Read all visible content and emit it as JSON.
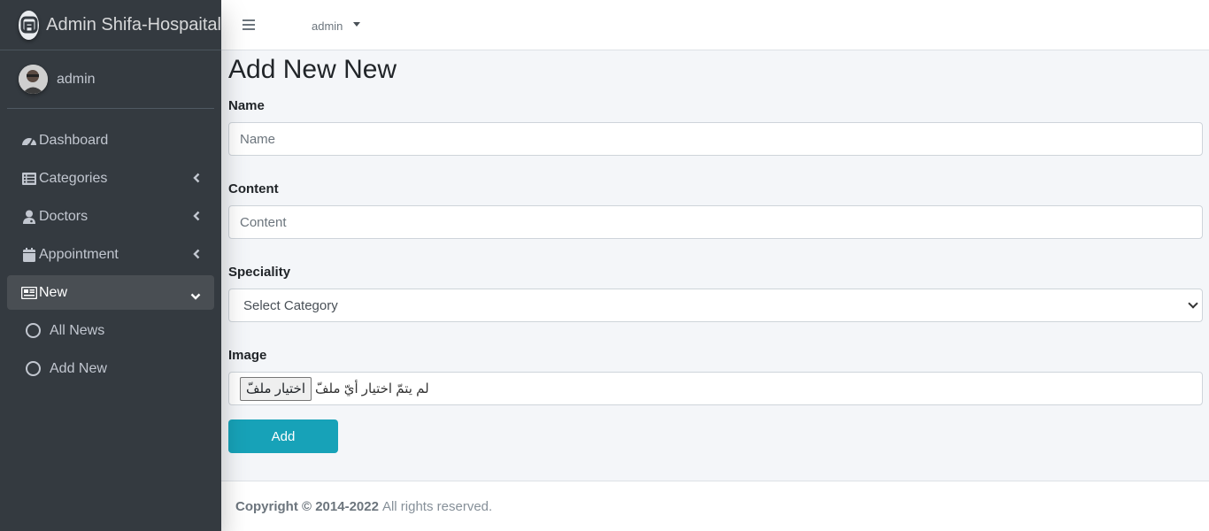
{
  "brand": {
    "title": "Admin Shifa-Hospaital"
  },
  "user": {
    "name": "admin"
  },
  "sidebar": {
    "items": [
      {
        "label": "Dashboard",
        "icon": "tachometer-icon"
      },
      {
        "label": "Categories",
        "icon": "list-icon"
      },
      {
        "label": "Doctors",
        "icon": "user-doctor-icon"
      },
      {
        "label": "Appointment",
        "icon": "calendar-icon"
      },
      {
        "label": "New",
        "icon": "newspaper-icon"
      }
    ],
    "sub_items": [
      {
        "label": "All News"
      },
      {
        "label": "Add New"
      }
    ]
  },
  "header": {
    "user_label": "admin"
  },
  "main": {
    "title": "Add New New",
    "name_label": "Name",
    "name_placeholder": "Name",
    "content_label": "Content",
    "content_placeholder": "Content",
    "speciality_label": "Speciality",
    "speciality_selected": "Select Category",
    "image_label": "Image",
    "file_button": "اختيار ملفّ",
    "file_status": "لم يتمّ اختيار أيّ ملفّ",
    "add_button": "Add"
  },
  "footer": {
    "copyright": "Copyright © 2014-2022",
    "rights": "All rights reserved."
  },
  "colors": {
    "sidebar_bg": "#343a40",
    "accent": "#17a2b8",
    "page_bg": "#f4f6f9"
  }
}
